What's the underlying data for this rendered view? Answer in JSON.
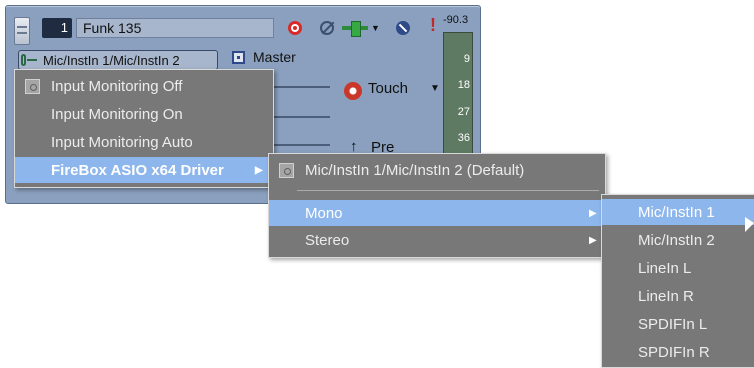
{
  "track": {
    "number": "1",
    "name": "Funk 135",
    "peak": "-90.3",
    "input": "Mic/InstIn 1/Mic/InstIn 2",
    "master": "Master",
    "touch": "Touch",
    "pre": "Pre",
    "meter_ticks": [
      "9",
      "18",
      "27",
      "36"
    ]
  },
  "menu1": {
    "items": [
      {
        "label": "Input Monitoring Off"
      },
      {
        "label": "Input Monitoring On"
      },
      {
        "label": "Input Monitoring Auto"
      },
      {
        "label": "FireBox ASIO x64 Driver"
      }
    ]
  },
  "menu2": {
    "items": [
      {
        "label": "Mic/InstIn 1/Mic/InstIn 2 (Default)"
      },
      {
        "label": "Mono"
      },
      {
        "label": "Stereo"
      }
    ]
  },
  "menu3": {
    "items": [
      {
        "label": "Mic/InstIn 1"
      },
      {
        "label": "Mic/InstIn 2"
      },
      {
        "label": "LineIn L"
      },
      {
        "label": "LineIn R"
      },
      {
        "label": "SPDIFIn L"
      },
      {
        "label": "SPDIFIn R"
      }
    ]
  },
  "colors": {
    "track_bg": "#8aa0be",
    "menu_bg": "#787878",
    "highlight": "#8db6ec",
    "record": "#d82a2a"
  }
}
